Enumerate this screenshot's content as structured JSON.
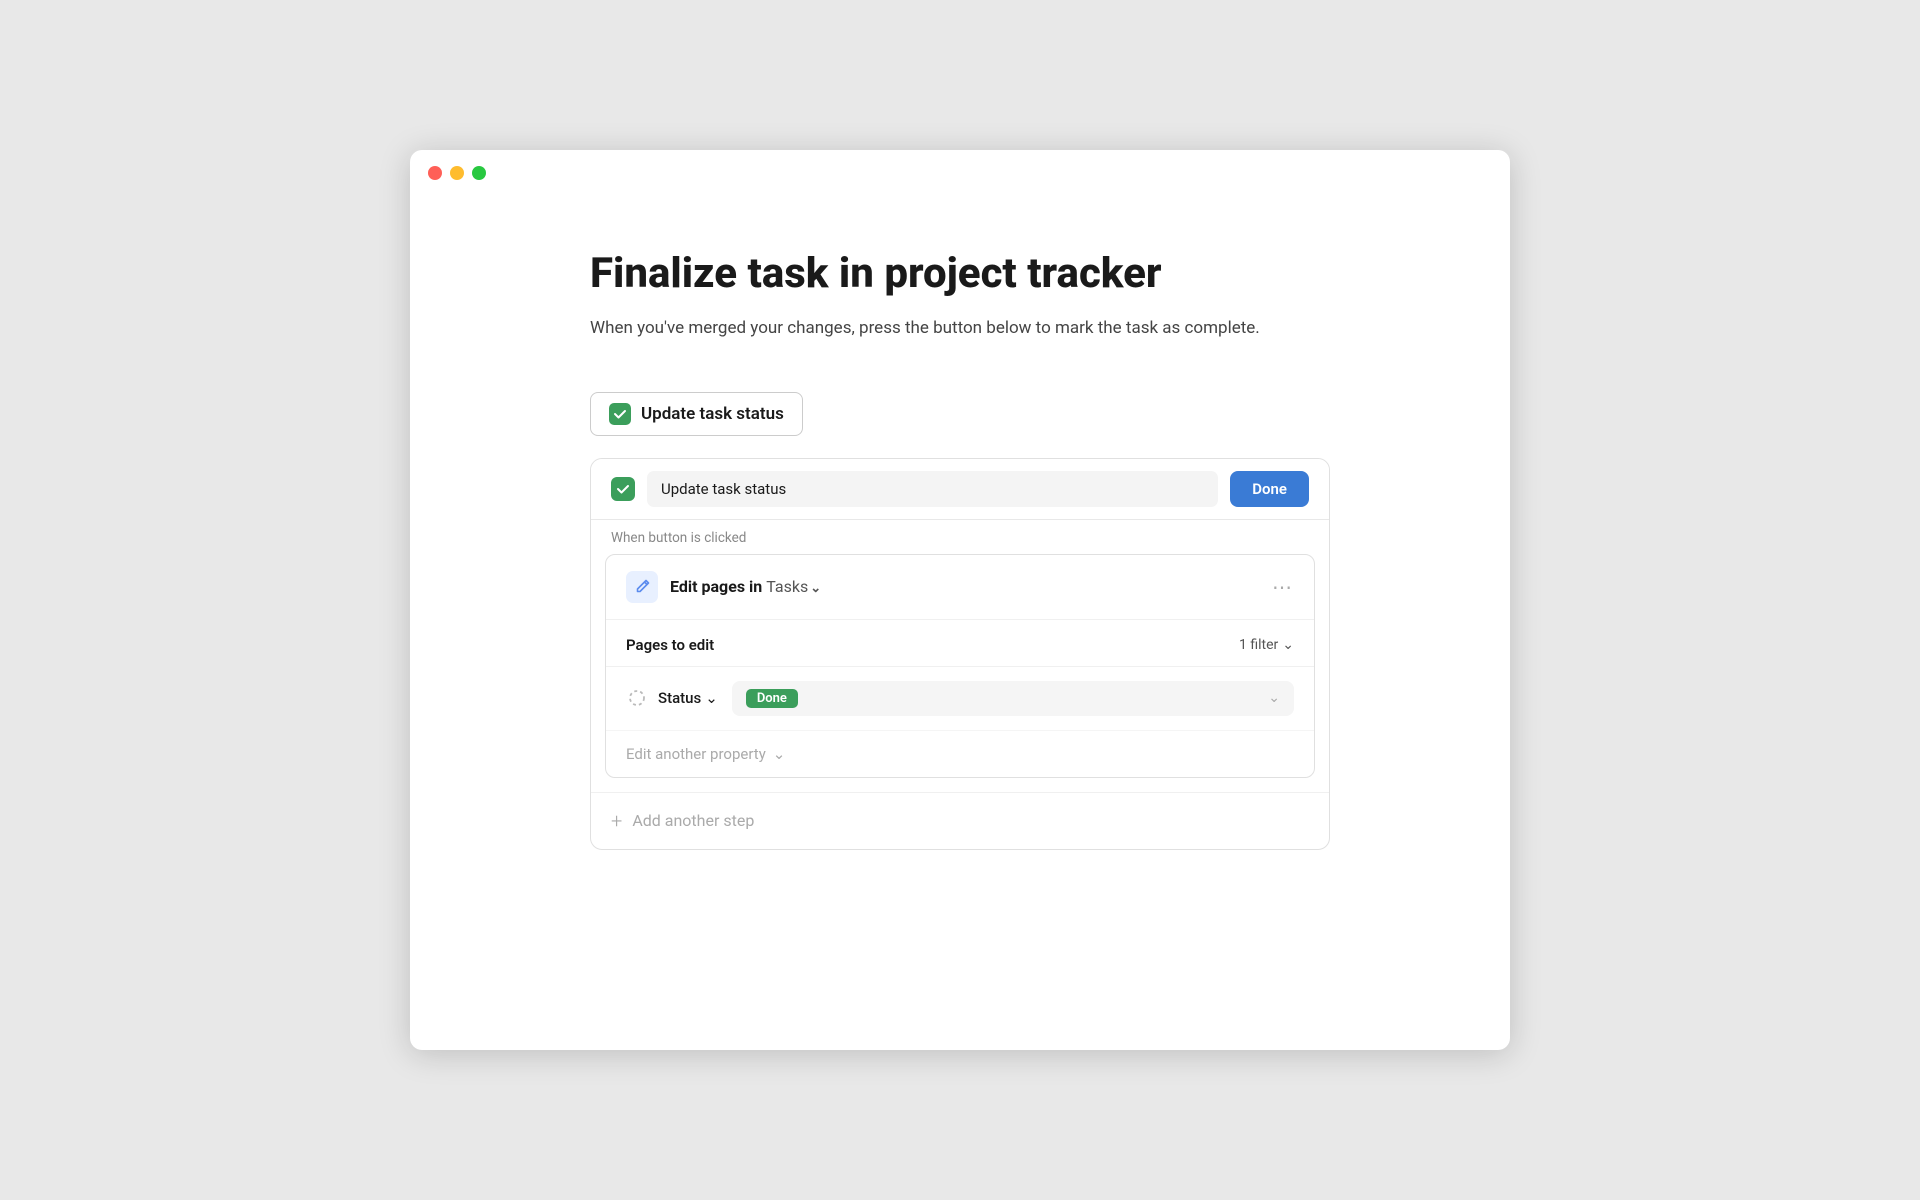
{
  "window": {
    "title": "Finalize task in project tracker"
  },
  "titlebar": {
    "traffic_lights": [
      "close",
      "minimize",
      "maximize"
    ]
  },
  "page": {
    "title": "Finalize task in project tracker",
    "description": "When you've merged your changes, press the button below to mark the task as complete."
  },
  "update_button": {
    "label": "Update task status",
    "checkbox_checked": true
  },
  "action_bar": {
    "input_value": "Update task status",
    "done_label": "Done"
  },
  "when_label": "When button is clicked",
  "edit_step": {
    "title_prefix": "Edit pages in",
    "db_name": "Tasks",
    "pages_label": "Pages to edit",
    "filter_label": "1 filter",
    "status_label": "Status",
    "status_value": "Done",
    "edit_another_label": "Edit another property"
  },
  "add_step": {
    "label": "Add another step"
  }
}
